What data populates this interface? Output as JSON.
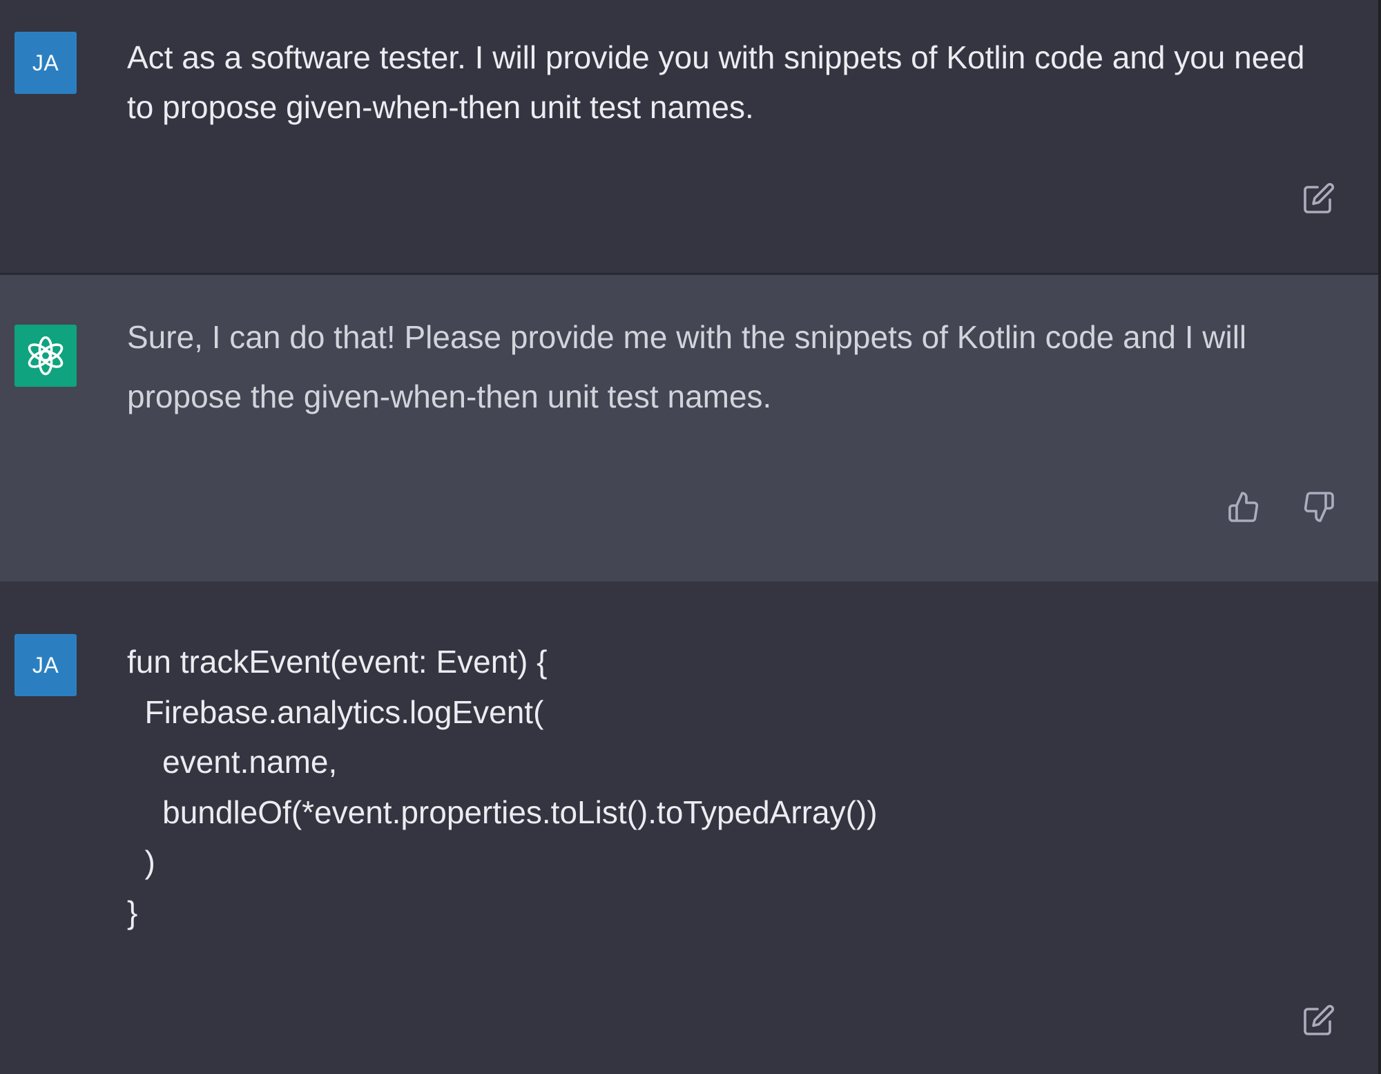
{
  "conversation": [
    {
      "role": "user",
      "avatar_initials": "JA",
      "text": "Act as a software tester. I will provide you with snippets of Kotlin code and you need to propose given-when-then unit test names."
    },
    {
      "role": "assistant",
      "text": "Sure, I can do that! Please provide me with the snippets of Kotlin code and I will propose the given-when-then unit test names."
    },
    {
      "role": "user",
      "avatar_initials": "JA",
      "code_lines": [
        "fun trackEvent(event: Event) {",
        "  Firebase.analytics.logEvent(",
        "    event.name,",
        "    bundleOf(*event.properties.toList().toTypedArray())",
        "  )",
        "}"
      ]
    }
  ],
  "icons": {
    "user_message_action": "edit-icon",
    "assistant_feedback": [
      "thumbs-up-icon",
      "thumbs-down-icon"
    ],
    "assistant_avatar": "openai-logo-icon"
  },
  "colors": {
    "user_background": "#343541",
    "assistant_background": "#444654",
    "user_avatar": "#2b7fc1",
    "assistant_avatar": "#10a37f"
  }
}
